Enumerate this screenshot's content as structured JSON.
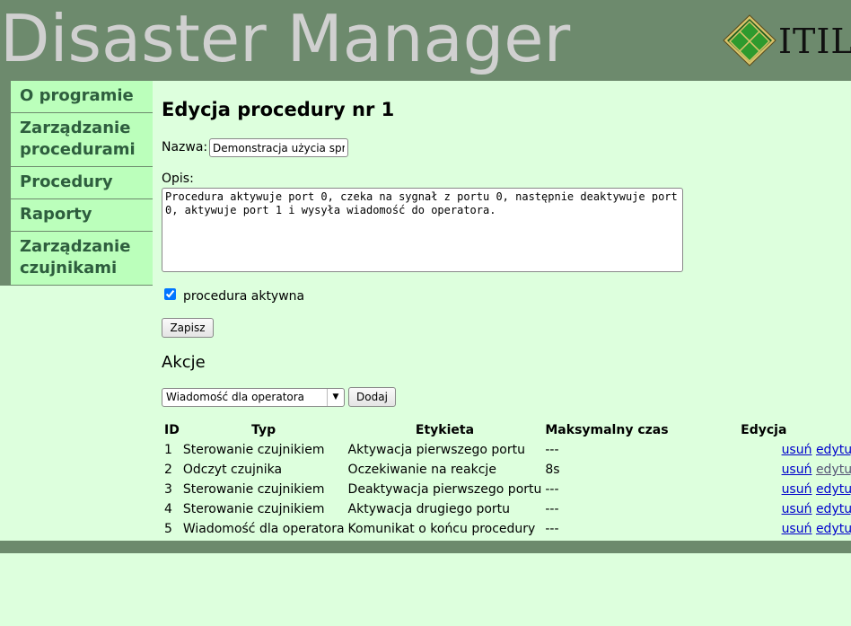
{
  "app": {
    "title": "Disaster Manager",
    "logo_text": "ITIL"
  },
  "sidebar": {
    "items": [
      {
        "label": "O programie"
      },
      {
        "label": "Zarządzanie procedurami"
      },
      {
        "label": "Procedury"
      },
      {
        "label": "Raporty"
      },
      {
        "label": "Zarządzanie czujnikami"
      }
    ]
  },
  "form": {
    "page_title": "Edycja procedury nr 1",
    "name_label": "Nazwa:",
    "name_value": "Demonstracja użycia sprzętu",
    "desc_label": "Opis:",
    "desc_value": "Procedura aktywuje port 0, czeka na sygnał z portu 0, następnie deaktywuje port 0, aktywuje port 1 i wysyła wiadomość do operatora.",
    "active_label": "procedura aktywna",
    "active_checked": true,
    "save_label": "Zapisz"
  },
  "actions": {
    "heading": "Akcje",
    "select_value": "Wiadomość dla operatora",
    "add_label": "Dodaj",
    "columns": [
      "ID",
      "Typ",
      "Etykieta",
      "Maksymalny czas",
      "Edycja"
    ],
    "delete_label": "usuń",
    "edit_label": "edytuj",
    "rows": [
      {
        "id": "1",
        "type": "Sterowanie czujnikiem",
        "label": "Aktywacja pierwszego portu",
        "max_time": "---"
      },
      {
        "id": "2",
        "type": "Odczyt czujnika",
        "label": "Oczekiwanie na reakcje",
        "max_time": "8s"
      },
      {
        "id": "3",
        "type": "Sterowanie czujnikiem",
        "label": "Deaktywacja pierwszego portu",
        "max_time": "---"
      },
      {
        "id": "4",
        "type": "Sterowanie czujnikiem",
        "label": "Aktywacja drugiego portu",
        "max_time": "---"
      },
      {
        "id": "5",
        "type": "Wiadomość dla operatora",
        "label": "Komunikat o końcu procedury",
        "max_time": "---"
      }
    ]
  },
  "colors": {
    "header_bg": "#6d8a6d",
    "page_bg": "#ddffdd",
    "nav_bg": "#bbffbb",
    "nav_text": "#2e5e3e",
    "link": "#0000cc"
  }
}
